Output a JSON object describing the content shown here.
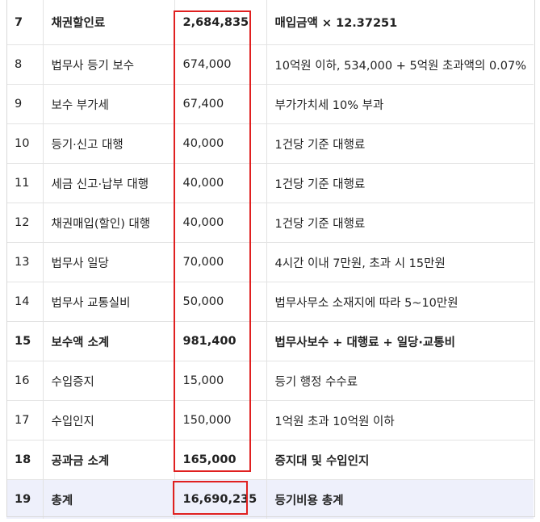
{
  "rows": [
    {
      "no": "7",
      "item": "채권할인료",
      "amount": "2,684,835",
      "note": "매입금액 × 12.37251",
      "bold": true
    },
    {
      "no": "8",
      "item": "법무사 등기 보수",
      "amount": "674,000",
      "note": "10억원 이하, 534,000 + 5억원 초과액의 0.07%",
      "bold": false
    },
    {
      "no": "9",
      "item": "보수 부가세",
      "amount": "67,400",
      "note": "부가가치세 10% 부과",
      "bold": false
    },
    {
      "no": "10",
      "item": "등기·신고 대행",
      "amount": "40,000",
      "note": "1건당 기준 대행료",
      "bold": false
    },
    {
      "no": "11",
      "item": "세금 신고·납부 대행",
      "amount": "40,000",
      "note": "1건당 기준 대행료",
      "bold": false
    },
    {
      "no": "12",
      "item": "채권매입(할인) 대행",
      "amount": "40,000",
      "note": "1건당 기준 대행료",
      "bold": false
    },
    {
      "no": "13",
      "item": "법무사 일당",
      "amount": "70,000",
      "note": "4시간 이내 7만원, 초과 시 15만원",
      "bold": false
    },
    {
      "no": "14",
      "item": "법무사 교통실비",
      "amount": "50,000",
      "note": "법무사무소 소재지에 따라 5~10만원",
      "bold": false
    },
    {
      "no": "15",
      "item": "보수액 소계",
      "amount": "981,400",
      "note": "법무사보수 + 대행료 + 일당·교통비",
      "bold": true
    },
    {
      "no": "16",
      "item": "수입증지",
      "amount": "15,000",
      "note": "등기 행정 수수료",
      "bold": false
    },
    {
      "no": "17",
      "item": "수입인지",
      "amount": "150,000",
      "note": "1억원 초과 10억원 이하",
      "bold": false
    },
    {
      "no": "18",
      "item": "공과금 소계",
      "amount": "165,000",
      "note": "증지대 및 수입인지",
      "bold": true
    },
    {
      "no": "19",
      "item": "총계",
      "amount": "16,690,235",
      "note": "등기비용 총계",
      "bold": true,
      "total": true
    }
  ],
  "highlight_color": "#e02020",
  "total_row_background": "#eef0fb"
}
